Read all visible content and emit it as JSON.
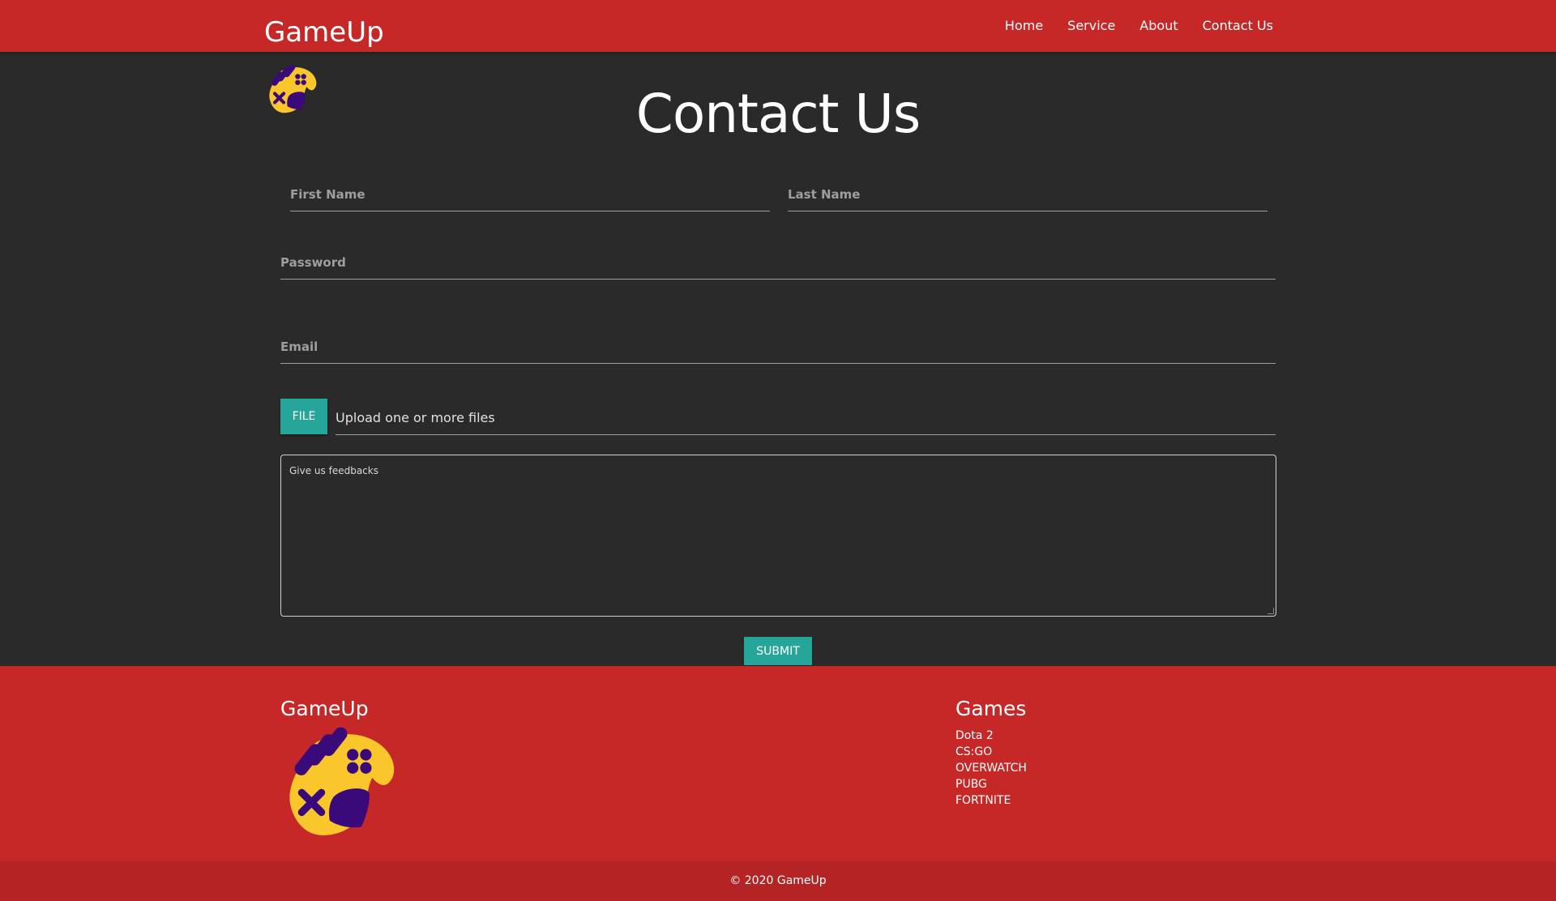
{
  "navbar": {
    "brand": "GameUp",
    "links": [
      "Home",
      "Service",
      "About",
      "Contact Us"
    ]
  },
  "main": {
    "title": "Contact Us",
    "form": {
      "first_name_label": "First Name",
      "last_name_label": "Last Name",
      "password_label": "Password",
      "email_label": "Email",
      "file_button": "FILE",
      "file_placeholder": "Upload one or more files",
      "feedback_placeholder": "Give us feedbacks",
      "submit_button": "SUBMIT"
    }
  },
  "footer": {
    "brand": "GameUp",
    "games_title": "Games",
    "games": [
      "Dota 2",
      "CS:GO",
      "OVERWATCH",
      "PUBG",
      "FORTNITE"
    ],
    "copyright": "© 2020 GameUp"
  },
  "colors": {
    "primary_red": "#c62828",
    "footer_bottom_red": "#b52424",
    "background_dark": "#2a2a2a",
    "teal_button": "#26a69a",
    "logo_yellow": "#f9c62b",
    "logo_purple": "#3b0a7a"
  },
  "icons": {
    "logo": "gamepad-icon"
  }
}
